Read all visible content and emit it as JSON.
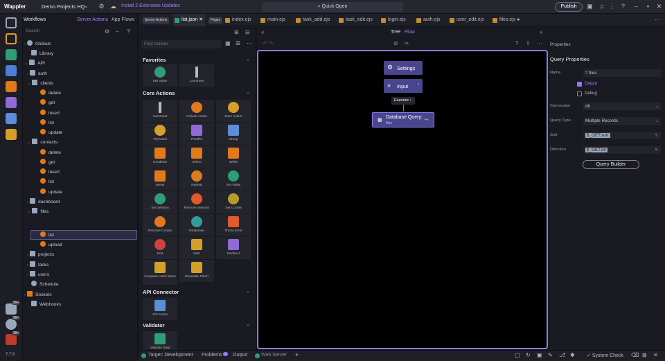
{
  "topbar": {
    "brand": "Wappler",
    "project": "Demo Projects HQ",
    "update": "Install 2 Extension Updates",
    "quick_open": "Quick Open",
    "publish": "Publish"
  },
  "rail": {
    "version": "7.7.6",
    "badges": [
      "99+",
      "99+",
      "99+"
    ]
  },
  "workflows": {
    "title": "Workflows",
    "tab_server": "Server Actions",
    "tab_app": "App Flows",
    "search_placeholder": "Search",
    "items": [
      "Globals",
      "Library",
      "API",
      "auth",
      "clients",
      "delete",
      "get",
      "insert",
      "list",
      "update",
      "contacts",
      "delete",
      "get",
      "insert",
      "list",
      "update",
      "dashboard",
      "files",
      "list",
      "upload",
      "projects",
      "tasks",
      "users",
      "Schedule",
      "Sockets",
      "Webhooks"
    ]
  },
  "actions": {
    "find_placeholder": "Find Actions",
    "favorites": {
      "title": "Favorites",
      "items": [
        "Set Value",
        "Comment"
      ]
    },
    "core": {
      "title": "Core Actions",
      "items": [
        "Comment",
        "Include Action",
        "Exec Action",
        "Try/Catch",
        "Parallel",
        "Group",
        "Condition",
        "Select",
        "While",
        "Repeat",
        "Set Value",
        "Set Session",
        "Remove Session",
        "Set Cookie",
        "Remove Cookie",
        "Response",
        "Throw Error",
        "End",
        "Wait",
        "Redirect",
        "Compare Hash Bytes",
        "Generate Token"
      ]
    },
    "connector": {
      "title": "API Connector",
      "items": [
        "API Action"
      ]
    },
    "validator": {
      "title": "Validator",
      "items": [
        "Validate Data"
      ]
    }
  },
  "tabs": {
    "server_actions": "Server Actions",
    "active": "list.json",
    "pages": "Pages",
    "files": [
      "index.ejs",
      "main.ejs",
      "task_add.ejs",
      "task_edit.ejs",
      "login.ejs",
      "auth.ejs",
      "user_edit.ejs",
      "files.ejs"
    ]
  },
  "editor": {
    "tree": "Tree",
    "flow": "Flow",
    "settings": "Settings",
    "input": "Input",
    "execute": "Execute",
    "node_title": "Database Query:",
    "node_sub": "files"
  },
  "props": {
    "panel": "Properties",
    "title": "Query Properties",
    "name_label": "Name",
    "name_value": "files",
    "output": "Output",
    "debug": "Debug",
    "connection_label": "Connection",
    "connection_value": "db",
    "query_type_label": "Query Type",
    "query_type_value": "Multiple Records",
    "sort_label": "Sort",
    "sort_value": "$_GET.sort",
    "direction_label": "Direction",
    "direction_value": "$_GET.dir",
    "builder": "Query Builder"
  },
  "status": {
    "target": "Target: Development",
    "problems": "Problems",
    "output": "Output",
    "web_server": "Web Server",
    "system_check": "System Check"
  },
  "colors": {
    "accent": "#8b7bff",
    "node": "#4a468d",
    "orange": "#e07a1a",
    "green": "#2f9e76"
  }
}
